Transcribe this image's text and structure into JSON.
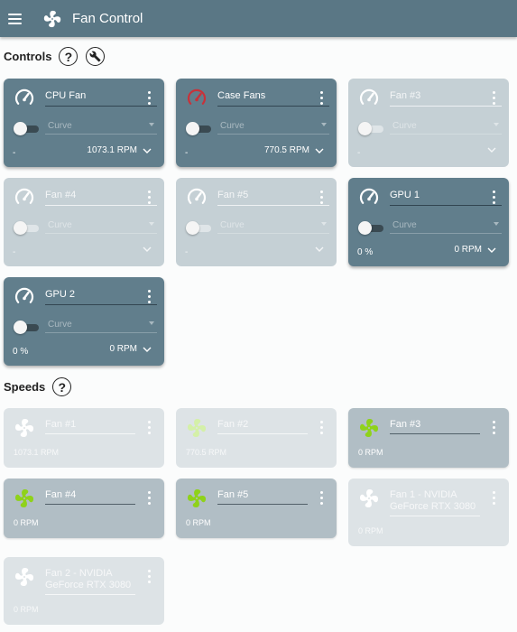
{
  "app": {
    "title": "Fan Control"
  },
  "sections": {
    "controls": "Controls",
    "speeds": "Speeds",
    "help_glyph": "?"
  },
  "controls": [
    {
      "name": "CPU Fan",
      "mode": "Curve",
      "pct": "-",
      "rpm": "1073.1 RPM",
      "active": true,
      "gauge_color": "#ffffff"
    },
    {
      "name": "Case Fans",
      "mode": "Curve",
      "pct": "-",
      "rpm": "770.5 RPM",
      "active": true,
      "gauge_color": "#c8323a"
    },
    {
      "name": "Fan #3",
      "mode": "Curve",
      "pct": "-",
      "rpm": "",
      "active": false,
      "gauge_color": "#ffffff"
    },
    {
      "name": "Fan #4",
      "mode": "Curve",
      "pct": "-",
      "rpm": "",
      "active": false,
      "gauge_color": "#ffffff"
    },
    {
      "name": "Fan #5",
      "mode": "Curve",
      "pct": "-",
      "rpm": "",
      "active": false,
      "gauge_color": "#ffffff"
    },
    {
      "name": "GPU 1",
      "mode": "Curve",
      "pct": "0 %",
      "rpm": "0 RPM",
      "active": true,
      "gauge_color": "#ffffff"
    },
    {
      "name": "GPU 2",
      "mode": "Curve",
      "pct": "0 %",
      "rpm": "0 RPM",
      "active": true,
      "gauge_color": "#ffffff"
    }
  ],
  "speeds": [
    {
      "name": "Fan #1",
      "rpm": "1073.1 RPM",
      "active": false,
      "icon_color": "#ffffff"
    },
    {
      "name": "Fan #2",
      "rpm": "770.5 RPM",
      "active": false,
      "icon_color": "#d4f0a8"
    },
    {
      "name": "Fan #3",
      "rpm": "0 RPM",
      "active": true,
      "icon_color": "#8fd21a"
    },
    {
      "name": "Fan #4",
      "rpm": "0 RPM",
      "active": true,
      "icon_color": "#8fd21a"
    },
    {
      "name": "Fan #5",
      "rpm": "0 RPM",
      "active": true,
      "icon_color": "#8fd21a"
    },
    {
      "name": "Fan 1 - NVIDIA GeForce RTX 3080",
      "rpm": "0 RPM",
      "active": false,
      "icon_color": "#ffffff"
    },
    {
      "name": "Fan 2 - NVIDIA GeForce RTX 3080",
      "rpm": "0 RPM",
      "active": false,
      "icon_color": "#ffffff"
    }
  ],
  "colors": {
    "appbar": "#5a7785",
    "card_active": "#617e8c",
    "card_inactive": "#c5d0d5",
    "speed_on": "#b1bec5",
    "speed_off": "#dde3e6",
    "accent_green": "#8fd21a",
    "accent_red": "#c8323a"
  }
}
